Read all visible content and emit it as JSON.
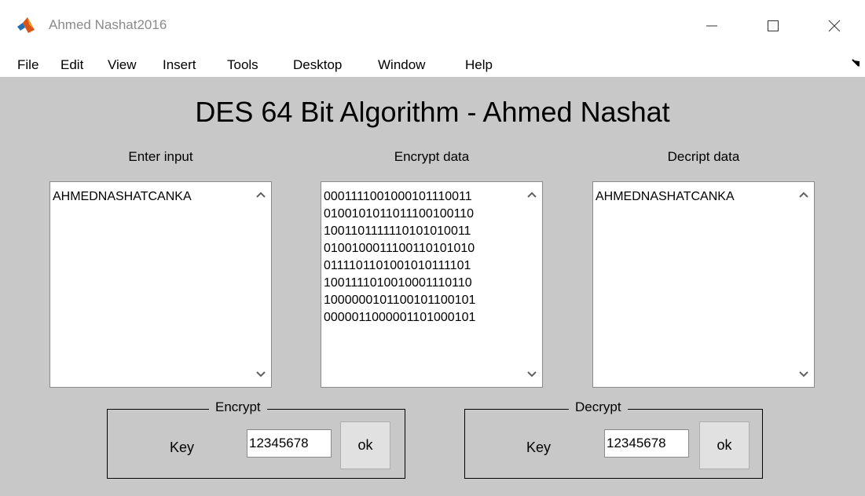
{
  "window": {
    "title": "Ahmed Nashat2016",
    "icon": "matlab-icon"
  },
  "menu": [
    "File",
    "Edit",
    "View",
    "Insert",
    "Tools",
    "Desktop",
    "Window",
    "Help"
  ],
  "figure": {
    "title": "DES 64 Bit Algorithm - Ahmed Nashat",
    "input": {
      "label": "Enter input",
      "text": "AHMEDNASHATCANKA"
    },
    "encrypt_data": {
      "label": "Encrypt data",
      "lines": [
        "0001111001000101110011",
        "0100101011011100100110",
        "1001101111110101010011",
        "0100100011100110101010",
        "0111101101001010111101",
        "1001111010010001110110",
        "1000000101100101100101",
        "0000011000001101000101"
      ]
    },
    "decrypt_data": {
      "label": "Decript data",
      "text": "AHMEDNASHATCANKA"
    },
    "encrypt_panel": {
      "title": "Encrypt",
      "key_label": "Key",
      "key_value": "12345678",
      "button": "ok"
    },
    "decrypt_panel": {
      "title": "Decrypt",
      "key_label": "Key",
      "key_value": "12345678",
      "button": "ok"
    }
  },
  "colors": {
    "canvas_bg": "#c8c8c8",
    "button_bg": "#e1e1e1",
    "title_text": "#8a8a8a"
  }
}
